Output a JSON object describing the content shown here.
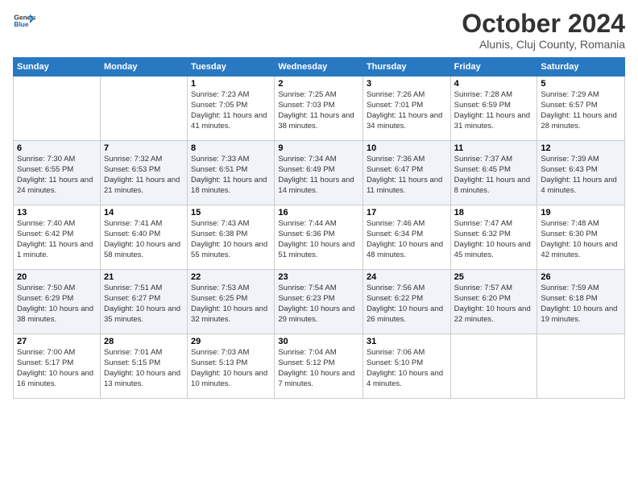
{
  "header": {
    "logo_general": "General",
    "logo_blue": "Blue",
    "month_title": "October 2024",
    "subtitle": "Alunis, Cluj County, Romania"
  },
  "days_of_week": [
    "Sunday",
    "Monday",
    "Tuesday",
    "Wednesday",
    "Thursday",
    "Friday",
    "Saturday"
  ],
  "weeks": [
    [
      {
        "day": "",
        "info": ""
      },
      {
        "day": "",
        "info": ""
      },
      {
        "day": "1",
        "info": "Sunrise: 7:23 AM\nSunset: 7:05 PM\nDaylight: 11 hours and 41 minutes."
      },
      {
        "day": "2",
        "info": "Sunrise: 7:25 AM\nSunset: 7:03 PM\nDaylight: 11 hours and 38 minutes."
      },
      {
        "day": "3",
        "info": "Sunrise: 7:26 AM\nSunset: 7:01 PM\nDaylight: 11 hours and 34 minutes."
      },
      {
        "day": "4",
        "info": "Sunrise: 7:28 AM\nSunset: 6:59 PM\nDaylight: 11 hours and 31 minutes."
      },
      {
        "day": "5",
        "info": "Sunrise: 7:29 AM\nSunset: 6:57 PM\nDaylight: 11 hours and 28 minutes."
      }
    ],
    [
      {
        "day": "6",
        "info": "Sunrise: 7:30 AM\nSunset: 6:55 PM\nDaylight: 11 hours and 24 minutes."
      },
      {
        "day": "7",
        "info": "Sunrise: 7:32 AM\nSunset: 6:53 PM\nDaylight: 11 hours and 21 minutes."
      },
      {
        "day": "8",
        "info": "Sunrise: 7:33 AM\nSunset: 6:51 PM\nDaylight: 11 hours and 18 minutes."
      },
      {
        "day": "9",
        "info": "Sunrise: 7:34 AM\nSunset: 6:49 PM\nDaylight: 11 hours and 14 minutes."
      },
      {
        "day": "10",
        "info": "Sunrise: 7:36 AM\nSunset: 6:47 PM\nDaylight: 11 hours and 11 minutes."
      },
      {
        "day": "11",
        "info": "Sunrise: 7:37 AM\nSunset: 6:45 PM\nDaylight: 11 hours and 8 minutes."
      },
      {
        "day": "12",
        "info": "Sunrise: 7:39 AM\nSunset: 6:43 PM\nDaylight: 11 hours and 4 minutes."
      }
    ],
    [
      {
        "day": "13",
        "info": "Sunrise: 7:40 AM\nSunset: 6:42 PM\nDaylight: 11 hours and 1 minute."
      },
      {
        "day": "14",
        "info": "Sunrise: 7:41 AM\nSunset: 6:40 PM\nDaylight: 10 hours and 58 minutes."
      },
      {
        "day": "15",
        "info": "Sunrise: 7:43 AM\nSunset: 6:38 PM\nDaylight: 10 hours and 55 minutes."
      },
      {
        "day": "16",
        "info": "Sunrise: 7:44 AM\nSunset: 6:36 PM\nDaylight: 10 hours and 51 minutes."
      },
      {
        "day": "17",
        "info": "Sunrise: 7:46 AM\nSunset: 6:34 PM\nDaylight: 10 hours and 48 minutes."
      },
      {
        "day": "18",
        "info": "Sunrise: 7:47 AM\nSunset: 6:32 PM\nDaylight: 10 hours and 45 minutes."
      },
      {
        "day": "19",
        "info": "Sunrise: 7:48 AM\nSunset: 6:30 PM\nDaylight: 10 hours and 42 minutes."
      }
    ],
    [
      {
        "day": "20",
        "info": "Sunrise: 7:50 AM\nSunset: 6:29 PM\nDaylight: 10 hours and 38 minutes."
      },
      {
        "day": "21",
        "info": "Sunrise: 7:51 AM\nSunset: 6:27 PM\nDaylight: 10 hours and 35 minutes."
      },
      {
        "day": "22",
        "info": "Sunrise: 7:53 AM\nSunset: 6:25 PM\nDaylight: 10 hours and 32 minutes."
      },
      {
        "day": "23",
        "info": "Sunrise: 7:54 AM\nSunset: 6:23 PM\nDaylight: 10 hours and 29 minutes."
      },
      {
        "day": "24",
        "info": "Sunrise: 7:56 AM\nSunset: 6:22 PM\nDaylight: 10 hours and 26 minutes."
      },
      {
        "day": "25",
        "info": "Sunrise: 7:57 AM\nSunset: 6:20 PM\nDaylight: 10 hours and 22 minutes."
      },
      {
        "day": "26",
        "info": "Sunrise: 7:59 AM\nSunset: 6:18 PM\nDaylight: 10 hours and 19 minutes."
      }
    ],
    [
      {
        "day": "27",
        "info": "Sunrise: 7:00 AM\nSunset: 5:17 PM\nDaylight: 10 hours and 16 minutes."
      },
      {
        "day": "28",
        "info": "Sunrise: 7:01 AM\nSunset: 5:15 PM\nDaylight: 10 hours and 13 minutes."
      },
      {
        "day": "29",
        "info": "Sunrise: 7:03 AM\nSunset: 5:13 PM\nDaylight: 10 hours and 10 minutes."
      },
      {
        "day": "30",
        "info": "Sunrise: 7:04 AM\nSunset: 5:12 PM\nDaylight: 10 hours and 7 minutes."
      },
      {
        "day": "31",
        "info": "Sunrise: 7:06 AM\nSunset: 5:10 PM\nDaylight: 10 hours and 4 minutes."
      },
      {
        "day": "",
        "info": ""
      },
      {
        "day": "",
        "info": ""
      }
    ]
  ]
}
